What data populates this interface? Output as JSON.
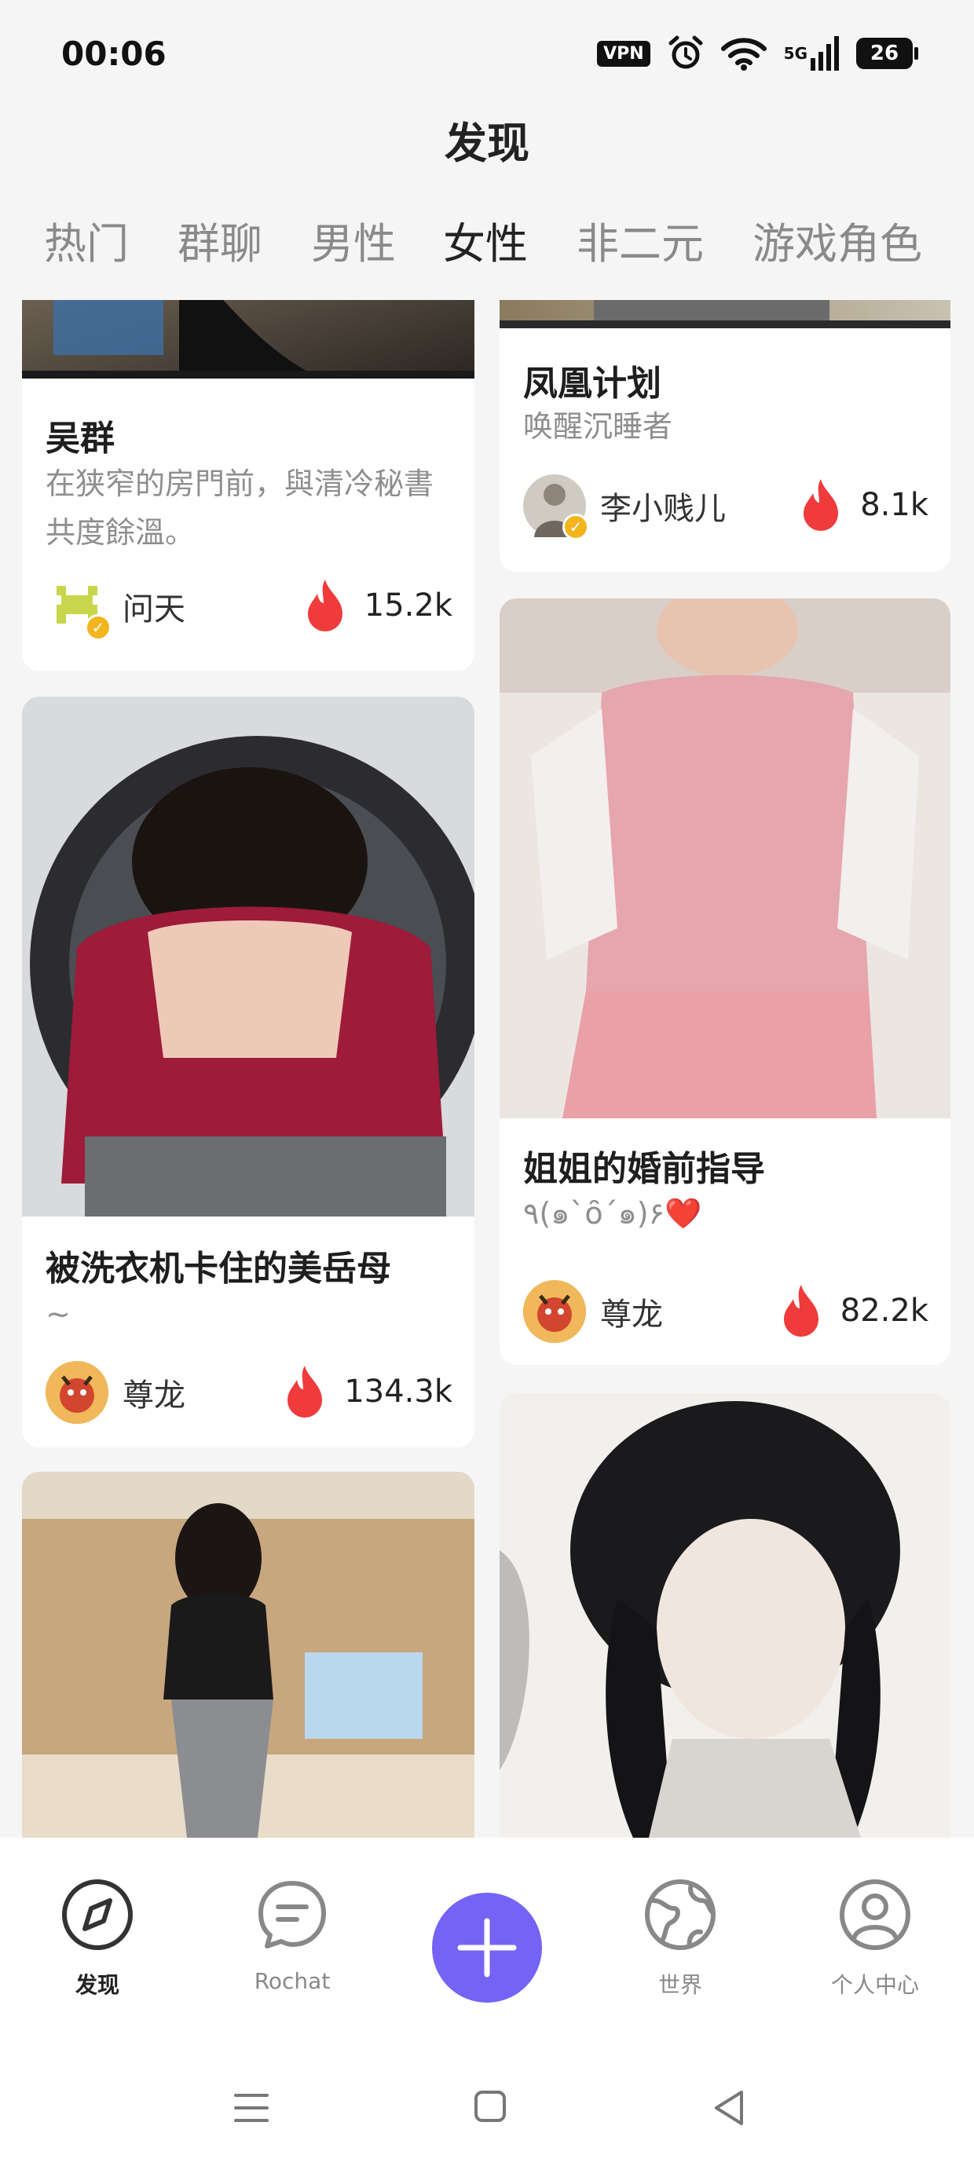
{
  "status_bar": {
    "time": "00:06",
    "vpn": "VPN",
    "network": "5G",
    "battery": "26"
  },
  "header": {
    "title": "发现"
  },
  "tabs": [
    {
      "label": "热门"
    },
    {
      "label": "群聊"
    },
    {
      "label": "男性"
    },
    {
      "label": "女性"
    },
    {
      "label": "非二元"
    },
    {
      "label": "游戏角色"
    }
  ],
  "selected_tab": "女性",
  "cards": [
    {
      "title": "吴群",
      "desc": "在狭窄的房門前，與清冷秘書共度餘溫。",
      "author": "问天",
      "heat": "15.2k",
      "verified": true
    },
    {
      "title": "凤凰计划",
      "desc": "唤醒沉睡者",
      "author": "李小贱儿",
      "heat": "8.1k",
      "verified": true
    },
    {
      "title": "被洗衣机卡住的美岳母",
      "desc": "~",
      "author": "尊龙",
      "heat": "134.3k",
      "verified": false
    },
    {
      "title": "姐姐的婚前指导",
      "desc": "٩(๑`ȏ´๑)۶❤️",
      "author": "尊龙",
      "heat": "82.2k",
      "verified": false
    }
  ],
  "nav": [
    {
      "label": "发现",
      "icon": "compass-icon"
    },
    {
      "label": "Rochat",
      "icon": "chat-bubble-icon"
    },
    {
      "label": "",
      "icon": "plus-icon"
    },
    {
      "label": "世界",
      "icon": "globe-icon"
    },
    {
      "label": "个人中心",
      "icon": "user-icon"
    }
  ],
  "colors": {
    "accent": "#7463f4",
    "heat": "#ef3b3b",
    "verified": "#f3b51d"
  }
}
